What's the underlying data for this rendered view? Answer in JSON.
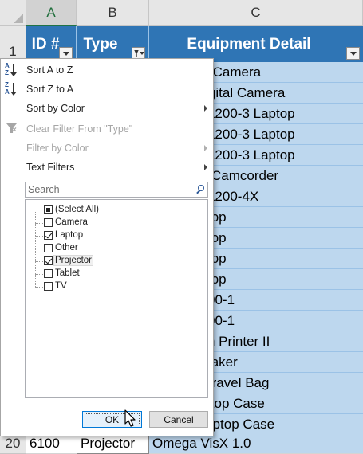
{
  "columns": [
    {
      "letter": "A",
      "selected": true
    },
    {
      "letter": "B",
      "selected": false
    },
    {
      "letter": "C",
      "selected": false
    }
  ],
  "header_row": {
    "row_number": "1",
    "id": "ID #",
    "type": "Type",
    "detail": "Equipment Detail"
  },
  "visible_detail_cells": [
    "na Digital Camera",
    "n Z-60 Digital Camera",
    "martPad L200-3 Laptop",
    "martPad L200-3 Laptop",
    "martPad L200-3 Laptop",
    "xL Digital Camcorder",
    "martPad L200-4X",
    "X-10 Laptop",
    "X-10 Laptop",
    "X-10 Laptop",
    "X-10 Laptop",
    "Board L500-1",
    "Board L500-1",
    "s DigiCam Printer II",
    "s Label Maker",
    " Camera Travel Bag",
    "olling Laptop Case",
    "Rolling Laptop Case"
  ],
  "last_row": {
    "row_number": "20",
    "id": "6100",
    "type": "Projector",
    "detail": "Omega VisX 1.0"
  },
  "filter_menu": {
    "sort_asc": "Sort A to Z",
    "sort_desc": "Sort Z to A",
    "sort_color": "Sort by Color",
    "clear_filter": "Clear Filter From \"Type\"",
    "filter_color": "Filter by Color",
    "text_filters": "Text Filters",
    "search_placeholder": "Search",
    "items": [
      {
        "label": "(Select All)",
        "state": "partial",
        "tree": false
      },
      {
        "label": "Camera",
        "state": "unchecked",
        "tree": true
      },
      {
        "label": "Laptop",
        "state": "checked",
        "tree": true
      },
      {
        "label": "Other",
        "state": "unchecked",
        "tree": true
      },
      {
        "label": "Projector",
        "state": "checked",
        "tree": true,
        "highlight": true
      },
      {
        "label": "Tablet",
        "state": "unchecked",
        "tree": true
      },
      {
        "label": "TV",
        "state": "unchecked",
        "tree": true
      }
    ],
    "ok_label": "OK",
    "cancel_label": "Cancel"
  },
  "colors": {
    "header_blue": "#2f75b5",
    "cell_blue": "#bdd7ee",
    "excel_green": "#217346"
  }
}
